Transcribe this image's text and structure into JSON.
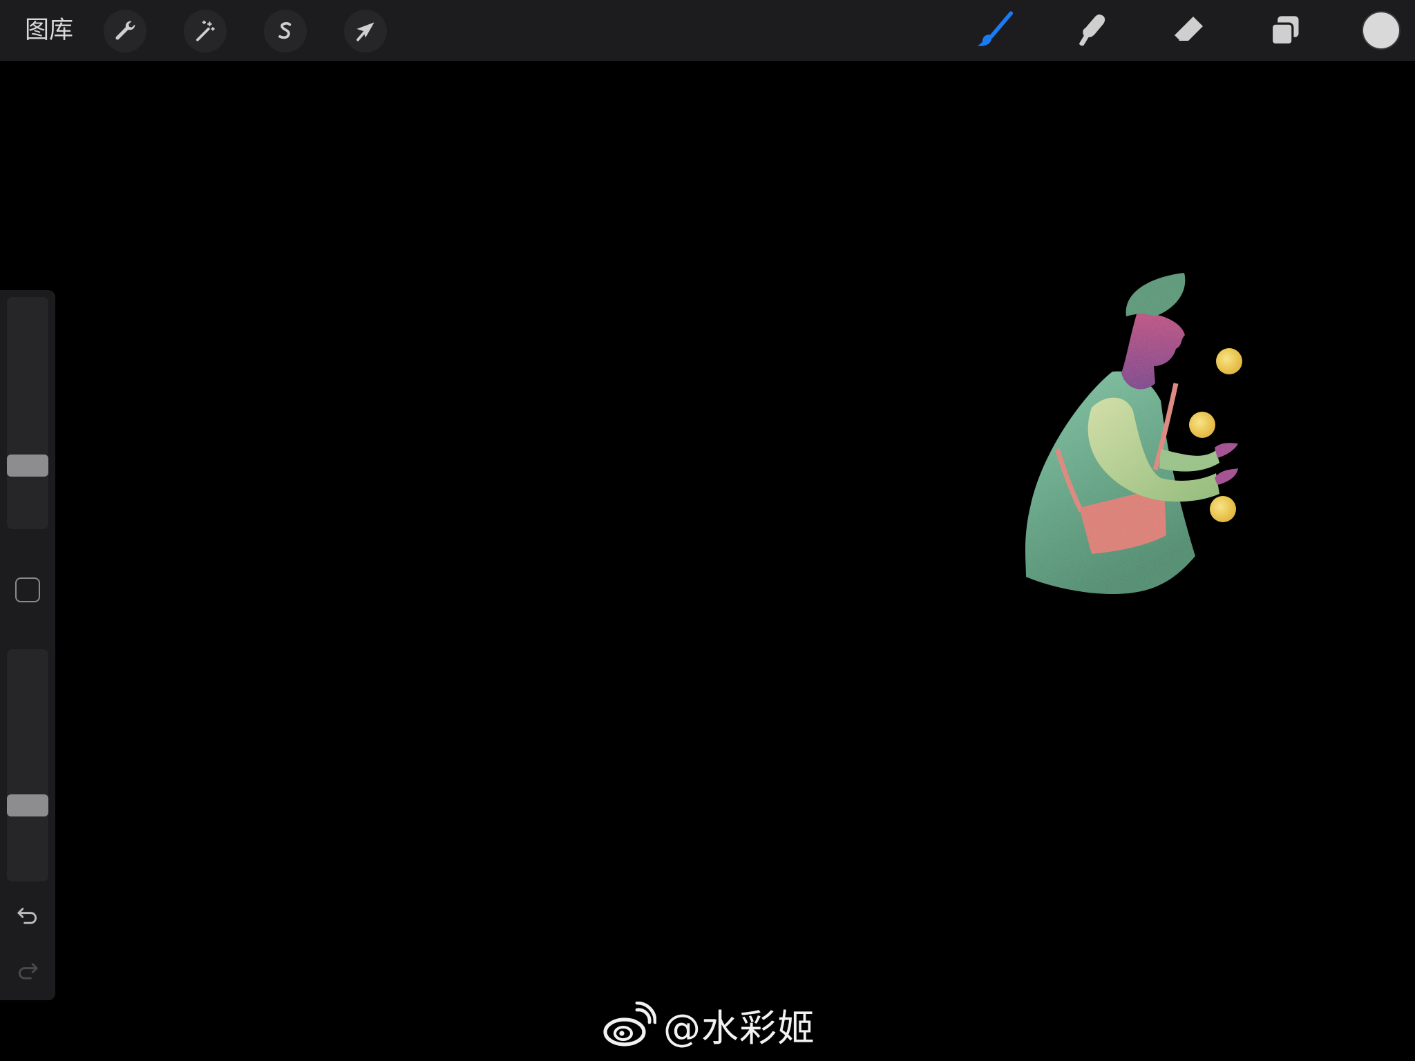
{
  "toolbar": {
    "gallery_label": "图库",
    "left_tools": [
      {
        "name": "actions",
        "icon": "wrench-icon"
      },
      {
        "name": "adjustments",
        "icon": "magic-wand-icon"
      },
      {
        "name": "selection",
        "icon": "selection-s-icon"
      },
      {
        "name": "transform",
        "icon": "arrow-cursor-icon"
      }
    ],
    "right_tools": [
      {
        "name": "brush",
        "icon": "paintbrush-icon",
        "active": true
      },
      {
        "name": "smudge",
        "icon": "smudge-finger-icon",
        "active": false
      },
      {
        "name": "eraser",
        "icon": "eraser-icon",
        "active": false
      },
      {
        "name": "layers",
        "icon": "layers-icon",
        "active": false
      }
    ],
    "current_color": "#d9d9d9",
    "accent_color": "#1a7cf5"
  },
  "sidebar": {
    "brush_size": 0.25,
    "opacity": 0.31,
    "undo_icon": "undo-arrow-icon",
    "redo_icon": "redo-arrow-icon",
    "redo_enabled": false
  },
  "watermark": {
    "logo": "weibo-logo-icon",
    "text": "@水彩姬"
  }
}
